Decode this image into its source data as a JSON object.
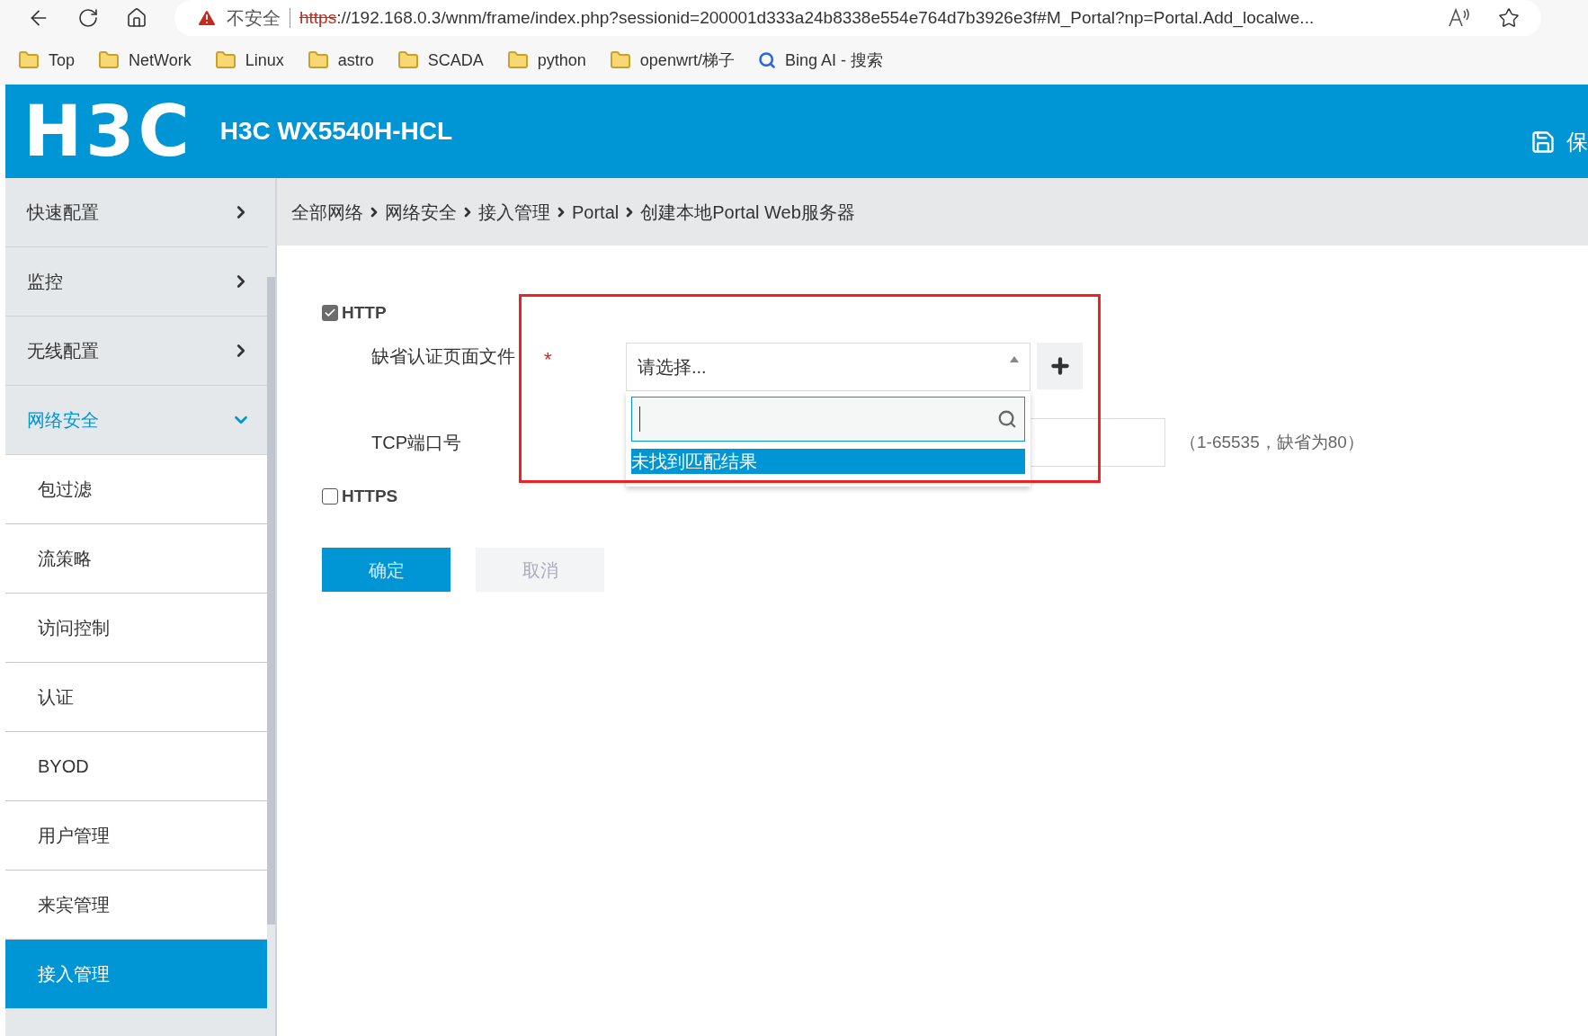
{
  "browser": {
    "security_label": "不安全",
    "url_scheme": "https",
    "url_rest": "://192.168.0.3/wnm/frame/index.php?sessionid=200001d333a24b8338e554e764d7b3926e3f#M_Portal?np=Portal.Add_localwe..."
  },
  "bookmarks": [
    {
      "label": "Top",
      "kind": "folder"
    },
    {
      "label": "NetWork",
      "kind": "folder"
    },
    {
      "label": "Linux",
      "kind": "folder"
    },
    {
      "label": "astro",
      "kind": "folder"
    },
    {
      "label": "SCADA",
      "kind": "folder"
    },
    {
      "label": "python",
      "kind": "folder"
    },
    {
      "label": "openwrt/梯子",
      "kind": "folder"
    },
    {
      "label": "Bing AI - 搜索",
      "kind": "search"
    }
  ],
  "header": {
    "logo": "H3C",
    "title": "H3C WX5540H-HCL",
    "save_label": "保"
  },
  "sidebar": [
    {
      "label": "快速配置",
      "expanded": false
    },
    {
      "label": "监控",
      "expanded": false
    },
    {
      "label": "无线配置",
      "expanded": false
    },
    {
      "label": "网络安全",
      "expanded": true,
      "children": [
        {
          "label": "包过滤",
          "selected": false
        },
        {
          "label": "流策略",
          "selected": false
        },
        {
          "label": "访问控制",
          "selected": false
        },
        {
          "label": "认证",
          "selected": false
        },
        {
          "label": "BYOD",
          "selected": false
        },
        {
          "label": "用户管理",
          "selected": false
        },
        {
          "label": "来宾管理",
          "selected": false
        },
        {
          "label": "接入管理",
          "selected": true
        }
      ]
    }
  ],
  "breadcrumb": [
    "全部网络",
    "网络安全",
    "接入管理",
    "Portal",
    "创建本地Portal Web服务器"
  ],
  "form": {
    "http": {
      "label": "HTTP",
      "checked": true
    },
    "file_field": {
      "label": "缺省认证页面文件",
      "required_mark": "*",
      "value": "请选择...",
      "expanded": true,
      "no_result": "未找到匹配结果"
    },
    "port_field": {
      "label": "TCP端口号",
      "hint": "（1-65535，缺省为80）"
    },
    "https": {
      "label": "HTTPS",
      "checked": false
    },
    "buttons": [
      {
        "label": "确定",
        "kind": "primary"
      },
      {
        "label": "取消",
        "kind": "disabled"
      }
    ]
  }
}
